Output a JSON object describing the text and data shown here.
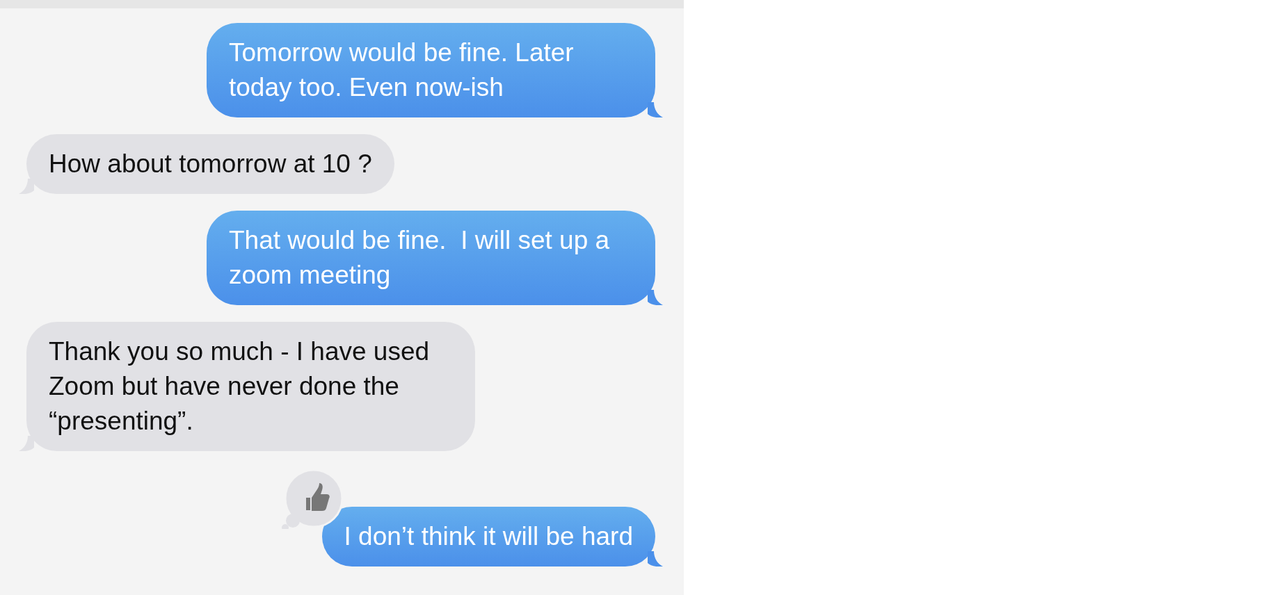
{
  "messages": [
    {
      "kind": "sent",
      "text": "Tomorrow would be fine. Later today too. Even now-ish",
      "thumbs_up": false
    },
    {
      "kind": "received",
      "text": "How about tomorrow at 10 ?",
      "thumbs_up": false
    },
    {
      "kind": "sent",
      "text": "That would be fine.  I will set up a zoom meeting",
      "thumbs_up": false
    },
    {
      "kind": "received",
      "text": "Thank you so much - I have used Zoom but have never done the “presenting”.",
      "thumbs_up": false
    },
    {
      "kind": "sent",
      "text": "I don’t think it will be hard",
      "thumbs_up": true
    }
  ]
}
